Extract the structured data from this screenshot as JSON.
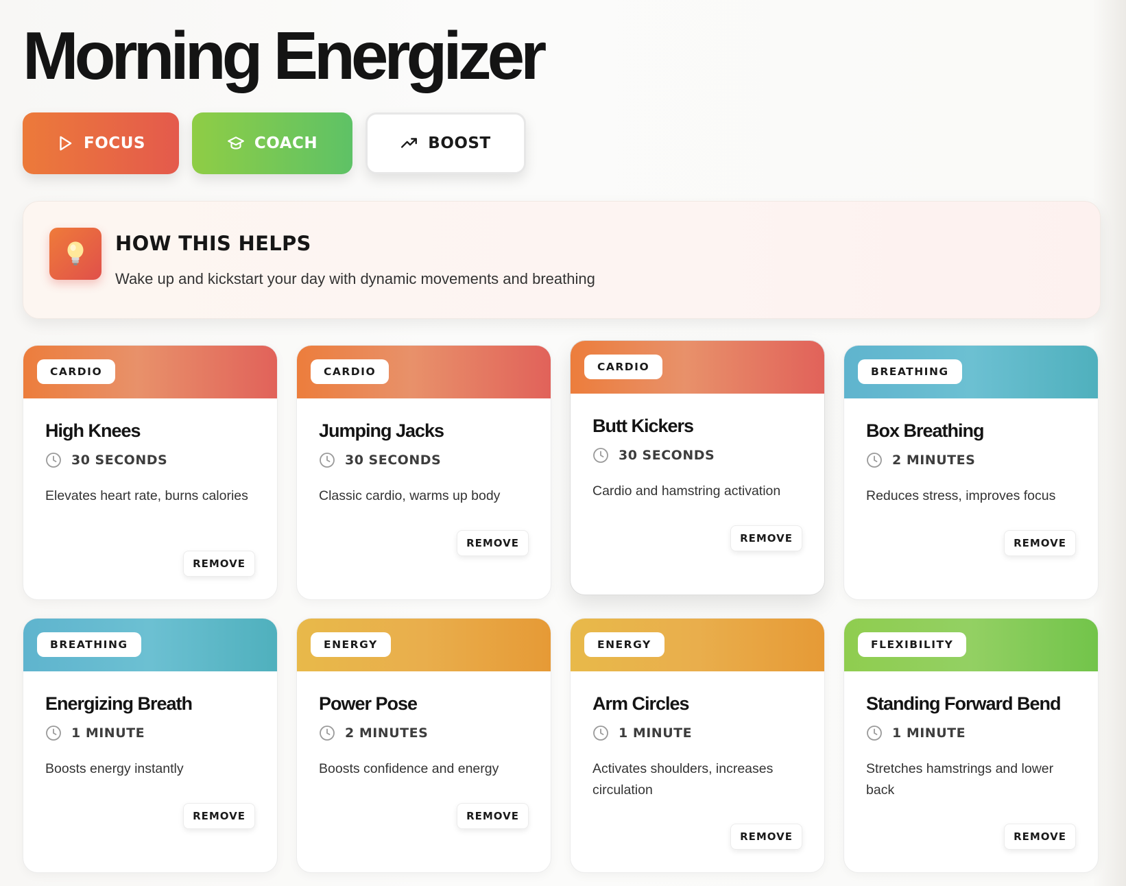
{
  "title": "Morning Energizer",
  "modes": [
    {
      "label": "FOCUS",
      "icon": "play-icon"
    },
    {
      "label": "COACH",
      "icon": "graduation-cap-icon"
    },
    {
      "label": "BOOST",
      "icon": "trending-up-icon"
    }
  ],
  "info": {
    "icon": "lightbulb-icon",
    "title": "HOW THIS HELPS",
    "text": "Wake up and kickstart your day with dynamic movements and breathing"
  },
  "colors": {
    "cardio": "#ec7d3c",
    "breathing": "#5fb4ce",
    "energy": "#e8b94a",
    "flexibility": "#8fcd4f",
    "focus": "#ec7a3a",
    "coach": "#8fcd45"
  },
  "remove_label": "REMOVE",
  "exercises": [
    {
      "category": "CARDIO",
      "title": "High Knees",
      "duration": "30 SECONDS",
      "description": "Elevates heart rate, burns calories"
    },
    {
      "category": "CARDIO",
      "title": "Jumping Jacks",
      "duration": "30 SECONDS",
      "description": "Classic cardio, warms up body"
    },
    {
      "category": "CARDIO",
      "title": "Butt Kickers",
      "duration": "30 SECONDS",
      "description": "Cardio and hamstring activation"
    },
    {
      "category": "BREATHING",
      "title": "Box Breathing",
      "duration": "2 MINUTES",
      "description": "Reduces stress, improves focus"
    },
    {
      "category": "BREATHING",
      "title": "Energizing Breath",
      "duration": "1 MINUTE",
      "description": "Boosts energy instantly"
    },
    {
      "category": "ENERGY",
      "title": "Power Pose",
      "duration": "2 MINUTES",
      "description": "Boosts confidence and energy"
    },
    {
      "category": "ENERGY",
      "title": "Arm Circles",
      "duration": "1 MINUTE",
      "description": "Activates shoulders, increases circulation"
    },
    {
      "category": "FLEXIBILITY",
      "title": "Standing Forward Bend",
      "duration": "1 MINUTE",
      "description": "Stretches hamstrings and lower back"
    }
  ]
}
